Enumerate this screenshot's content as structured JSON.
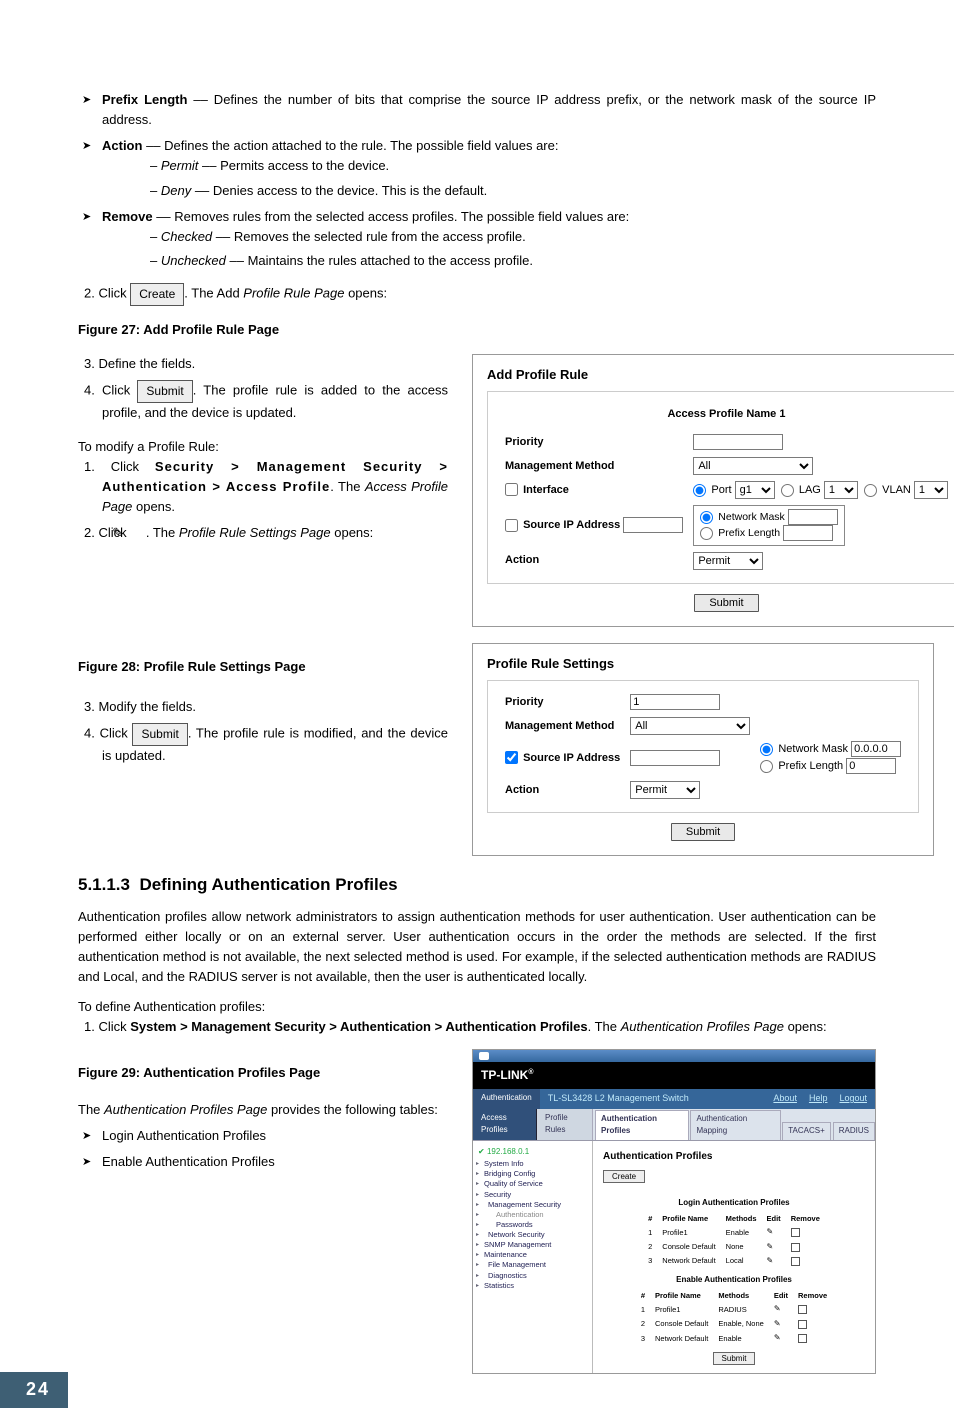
{
  "bullets": {
    "prefix_length": {
      "label": "Prefix Length",
      "text": " –– Defines the number of bits that comprise the source IP address prefix, or the network mask of the source IP address."
    },
    "action": {
      "label": "Action",
      "text": " –– Defines the action attached to the rule. The possible field values are:"
    },
    "permit": {
      "label": "Permit",
      "text": " –– Permits access to the device."
    },
    "deny": {
      "label": "Deny",
      "text": " –– Denies access to the device. This is the default."
    },
    "remove": {
      "label": "Remove",
      "text": " –– Removes rules from the selected access profiles. The possible field values are:"
    },
    "checked": {
      "label": "Checked",
      "text": " –– Removes the selected rule from the access profile."
    },
    "unchecked": {
      "label": "Unchecked",
      "text": " –– Maintains the rules attached to the access profile."
    }
  },
  "step2": {
    "prefix": "2.  Click ",
    "btn": "Create",
    "suffix_a": ". The Add ",
    "suffix_i": "Profile Rule Page",
    "suffix_b": " opens:"
  },
  "fig27": "Figure 27: Add Profile Rule Page",
  "steps_a": {
    "s3": "3.  Define the fields.",
    "s4_pre": "4.  Click ",
    "s4_btn": "Submit",
    "s4_post": ". The profile rule is added to the access profile, and the device is updated."
  },
  "mod_intro": "To modify a Profile Rule:",
  "mod_step1_a": "1. Click ",
  "mod_step1_path": "Security > Management Security > Authentication > Access Profile",
  "mod_step1_b": ". The ",
  "mod_step1_i": "Access Profile Page",
  "mod_step1_c": " opens.",
  "mod_step2_a": "2.  Click  ",
  "mod_step2_icon": "✎",
  "mod_step2_b": " . The ",
  "mod_step2_i": "Profile Rule Settings Page",
  "mod_step2_c": " opens:",
  "fig28": "Figure 28: Profile Rule Settings Page",
  "mod_s3": "3.  Modify the fields.",
  "mod_s4_pre": "4.  Click ",
  "mod_s4_btn": "Submit",
  "mod_s4_post": ". The profile rule is modified, and the device is updated.",
  "panel_add": {
    "title": "Add Profile Rule",
    "subtitle": "Access Profile Name 1",
    "rows": {
      "priority": "Priority",
      "method": "Management Method",
      "method_val": "All",
      "interface": "Interface",
      "port": "Port",
      "port_val": "g1",
      "lag": "LAG",
      "lag_val": "1",
      "vlan": "VLAN",
      "vlan_val": "1",
      "src": "Source IP Address",
      "mask": "Network Mask",
      "plen": "Prefix Length",
      "action": "Action",
      "action_val": "Permit"
    },
    "submit": "Submit"
  },
  "panel_settings": {
    "title": "Profile Rule Settings",
    "rows": {
      "priority": "Priority",
      "priority_val": "1",
      "method": "Management Method",
      "method_val": "All",
      "src": "Source IP Address",
      "mask": "Network Mask",
      "mask_val": "0.0.0.0",
      "plen": "Prefix Length",
      "plen_val": "0",
      "action": "Action",
      "action_val": "Permit"
    },
    "submit": "Submit"
  },
  "section": {
    "num": "5.1.1.3",
    "title": "Defining Authentication Profiles",
    "para": "Authentication profiles allow network administrators to assign authentication methods for user authentication. User authentication can be performed either locally or on an external server. User authentication occurs in the order the methods are selected. If the first authentication method is not available, the next selected method is used. For example, if the selected authentication methods are RADIUS and Local, and the RADIUS server is not available, then the user is authenticated locally.",
    "intro": "To define Authentication profiles:",
    "step1_a": "1.  Click ",
    "step1_path": "System > Management Security > Authentication > Authentication Profiles",
    "step1_b": ". The ",
    "step1_i": "Authentication Profiles Page",
    "step1_c": " opens:"
  },
  "fig29": "Figure 29: Authentication Profiles Page",
  "fig29_intro_a": "The ",
  "fig29_intro_i": "Authentication Profiles Page",
  "fig29_intro_b": " provides the following tables:",
  "fig29_b1": "Login Authentication Profiles",
  "fig29_b2": "Enable Authentication Profiles",
  "app": {
    "brand": "TP-LINK",
    "side_header": "Authentication",
    "titlebar": "TL-SL3428 L2 Management Switch",
    "links": {
      "about": "About",
      "help": "Help",
      "logout": "Logout"
    },
    "side_tabs": {
      "a": "Access Profiles",
      "b": "Profile Rules"
    },
    "main_tabs": {
      "a": "Authentication Profiles",
      "b": "Authentication Mapping",
      "c": "TACACS+",
      "d": "RADIUS"
    },
    "ip": "192.168.0.1",
    "tree": [
      "System Info",
      "Bridging Config",
      "Quality of Service",
      "Security",
      "Management Security",
      "Authentication",
      "Passwords",
      "Network Security",
      "SNMP Management",
      "Maintenance",
      "File Management",
      "Diagnostics",
      "Statistics"
    ],
    "main_title": "Authentication Profiles",
    "create_btn": "Create",
    "tbl1_title": "Login Authentication Profiles",
    "tbl_headers": [
      "#",
      "Profile Name",
      "Methods",
      "Edit",
      "Remove"
    ],
    "tbl1_rows": [
      [
        "1",
        "Profile1",
        "Enable",
        "✎",
        ""
      ],
      [
        "2",
        "Console Default",
        "None",
        "✎",
        ""
      ],
      [
        "3",
        "Network Default",
        "Local",
        "✎",
        ""
      ]
    ],
    "tbl2_title": "Enable Authentication Profiles",
    "tbl2_rows": [
      [
        "1",
        "Profile1",
        "RADIUS",
        "✎",
        ""
      ],
      [
        "2",
        "Console Default",
        "Enable, None",
        "✎",
        ""
      ],
      [
        "3",
        "Network Default",
        "Enable",
        "✎",
        ""
      ]
    ],
    "submit": "Submit"
  },
  "page_number": "24"
}
